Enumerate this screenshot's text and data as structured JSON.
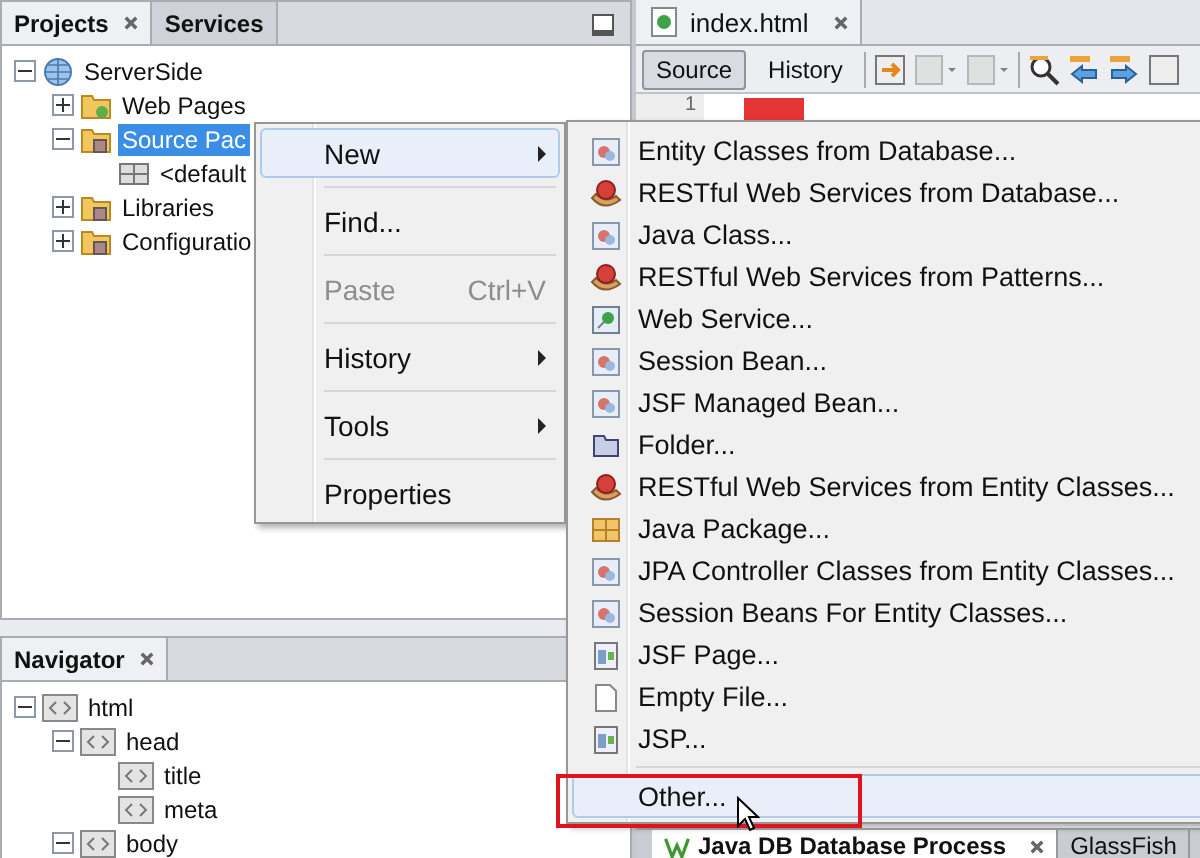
{
  "projects": {
    "tabs": [
      {
        "label": "Projects",
        "selected": true,
        "closable": true
      },
      {
        "label": "Services",
        "selected": false,
        "closable": false
      }
    ],
    "tree": [
      {
        "label": "ServerSide",
        "kind": "project",
        "expanded": true,
        "selected": false,
        "children": [
          {
            "label": "Web Pages",
            "kind": "web",
            "expanded": false,
            "selected": false
          },
          {
            "label": "Source Pac",
            "kind": "source",
            "expanded": true,
            "selected": true,
            "children": [
              {
                "label": "<default",
                "kind": "package",
                "selected": false
              }
            ]
          },
          {
            "label": "Libraries",
            "kind": "library",
            "expanded": false,
            "selected": false
          },
          {
            "label": "Configuratio",
            "kind": "config",
            "expanded": false,
            "selected": false
          }
        ]
      }
    ]
  },
  "navigator": {
    "tabs": [
      {
        "label": "Navigator",
        "selected": true,
        "closable": true
      }
    ],
    "tree": [
      {
        "label": "html",
        "kind": "tag",
        "expanded": true,
        "selected": false,
        "children": [
          {
            "label": "head",
            "kind": "tag",
            "expanded": true,
            "selected": false,
            "children": [
              {
                "label": "title",
                "kind": "tag",
                "selected": false
              },
              {
                "label": "meta",
                "kind": "tag",
                "selected": false
              }
            ]
          },
          {
            "label": "body",
            "kind": "tag",
            "expanded": true,
            "selected": false
          }
        ]
      }
    ]
  },
  "editor": {
    "tabs": [
      {
        "label": "index.html",
        "selected": true,
        "closable": true
      }
    ],
    "views": [
      {
        "label": "Source",
        "selected": true
      },
      {
        "label": "History",
        "selected": false
      }
    ],
    "line_numbers": [
      "1"
    ]
  },
  "output": {
    "tabs": [
      {
        "label": "Java DB Database Process",
        "selected": true,
        "closable": true
      },
      {
        "label": "GlassFish",
        "selected": false,
        "closable": false
      }
    ]
  },
  "context_menu": {
    "items": [
      {
        "label": "New",
        "selected": true,
        "disabled": false,
        "submenu": true
      },
      {
        "label": "Find...",
        "selected": false,
        "disabled": false,
        "submenu": false
      },
      {
        "label": "Paste",
        "shortcut": "Ctrl+V",
        "selected": false,
        "disabled": true,
        "submenu": false
      },
      {
        "label": "History",
        "selected": false,
        "disabled": false,
        "submenu": true
      },
      {
        "label": "Tools",
        "selected": false,
        "disabled": false,
        "submenu": true
      },
      {
        "label": "Properties",
        "selected": false,
        "disabled": false,
        "submenu": false
      }
    ]
  },
  "new_submenu": {
    "items": [
      {
        "label": "Entity Classes from Database...",
        "kind": "class",
        "selected": false
      },
      {
        "label": "RESTful Web Services from Database...",
        "kind": "rest",
        "selected": false
      },
      {
        "label": "Java Class...",
        "kind": "class",
        "selected": false
      },
      {
        "label": "RESTful Web Services from Patterns...",
        "kind": "rest",
        "selected": false
      },
      {
        "label": "Web Service...",
        "kind": "service",
        "selected": false
      },
      {
        "label": "Session Bean...",
        "kind": "class",
        "selected": false
      },
      {
        "label": "JSF Managed Bean...",
        "kind": "class",
        "selected": false
      },
      {
        "label": "Folder...",
        "kind": "folder",
        "selected": false
      },
      {
        "label": "RESTful Web Services from Entity Classes...",
        "kind": "rest",
        "selected": false
      },
      {
        "label": "Java Package...",
        "kind": "package",
        "selected": false
      },
      {
        "label": "JPA Controller Classes from Entity Classes...",
        "kind": "class",
        "selected": false
      },
      {
        "label": "Session Beans For Entity Classes...",
        "kind": "class",
        "selected": false
      },
      {
        "label": "JSF Page...",
        "kind": "page",
        "selected": false
      },
      {
        "label": "Empty File...",
        "kind": "file",
        "selected": false
      },
      {
        "label": "JSP...",
        "kind": "page",
        "selected": false
      },
      {
        "label": "Other...",
        "kind": "other",
        "selected": true
      }
    ]
  }
}
